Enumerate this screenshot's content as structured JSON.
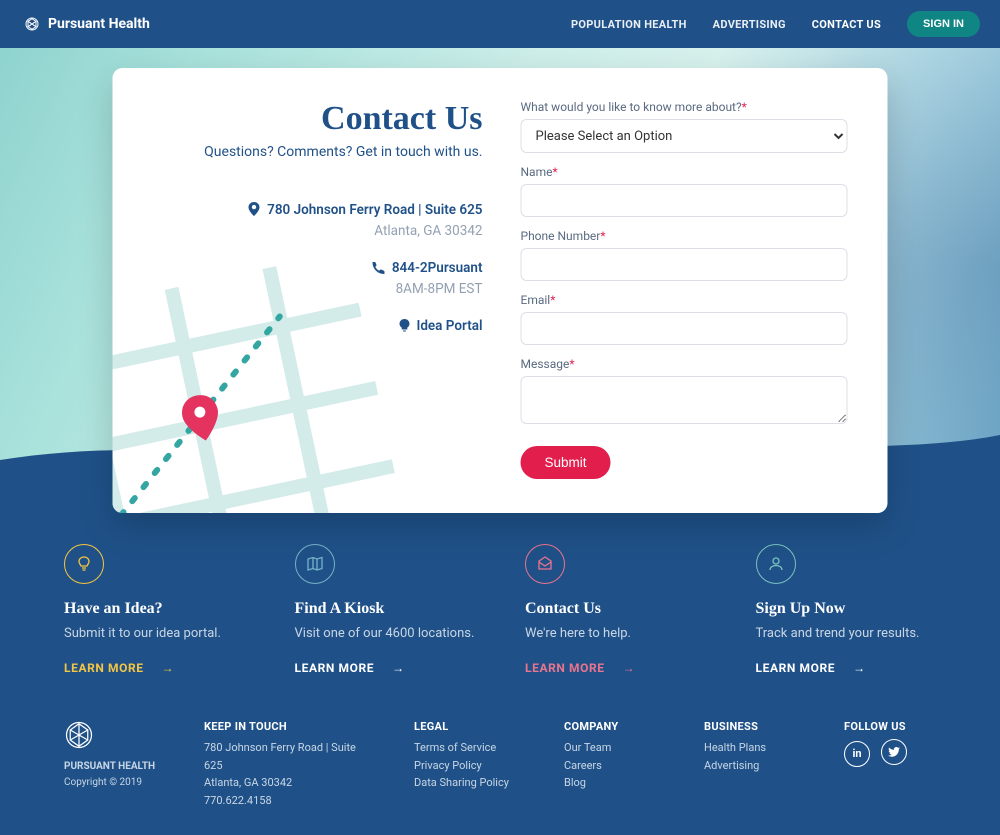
{
  "brand": "Pursuant Health",
  "nav": {
    "items": [
      "POPULATION HEALTH",
      "ADVERTISING",
      "CONTACT US"
    ],
    "signin": "SIGN IN"
  },
  "contact": {
    "title": "Contact Us",
    "subtitle": "Questions? Comments? Get in touch with us.",
    "address_line1": "780 Johnson Ferry Road | Suite 625",
    "address_line2": "Atlanta, GA 30342",
    "phone": "844-2Pursuant",
    "hours": "8AM-8PM EST",
    "idea": "Idea Portal"
  },
  "form": {
    "topic_label": "What would you like to know more about?",
    "topic_value": "Please Select an Option",
    "name_label": "Name",
    "phone_label": "Phone Number",
    "email_label": "Email",
    "message_label": "Message",
    "submit": "Submit"
  },
  "features": [
    {
      "title": "Have an Idea?",
      "desc": "Submit it to our idea portal.",
      "cta": "LEARN MORE"
    },
    {
      "title": "Find A Kiosk",
      "desc": "Visit one of our 4600 locations.",
      "cta": "LEARN MORE"
    },
    {
      "title": "Contact Us",
      "desc": "We're here to help.",
      "cta": "LEARN MORE"
    },
    {
      "title": "Sign Up Now",
      "desc": "Track and trend your results.",
      "cta": "LEARN MORE"
    }
  ],
  "footer": {
    "brand": "PURSUANT HEALTH",
    "copyright": "Copyright © 2019",
    "keep_title": "KEEP IN TOUCH",
    "keep": [
      "780 Johnson Ferry Road | Suite 625",
      "Atlanta, GA 30342",
      "770.622.4158"
    ],
    "legal_title": "LEGAL",
    "legal": [
      "Terms of Service",
      "Privacy Policy",
      "Data Sharing Policy"
    ],
    "company_title": "COMPANY",
    "company": [
      "Our Team",
      "Careers",
      "Blog"
    ],
    "business_title": "BUSINESS",
    "business": [
      "Health Plans",
      "Advertising"
    ],
    "follow": "FOLLOW US"
  },
  "colors": {
    "primary": "#1f5188",
    "accent": "#e21e4d",
    "teal": "#0f8584"
  }
}
